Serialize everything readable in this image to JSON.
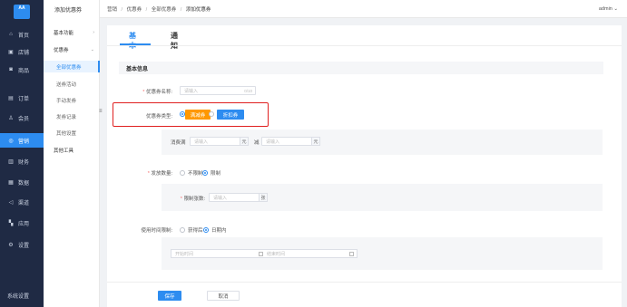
{
  "sidebar": {
    "logo_text": "AA",
    "items": [
      {
        "label": "首页",
        "icon": "home-icon",
        "glyph": "⌂"
      },
      {
        "label": "店铺",
        "icon": "store-icon",
        "glyph": "▣"
      },
      {
        "label": "商品",
        "icon": "goods-icon",
        "glyph": "◙"
      },
      {
        "label": "订单",
        "icon": "order-icon",
        "glyph": "▤"
      },
      {
        "label": "会员",
        "icon": "member-icon",
        "glyph": "♙"
      },
      {
        "label": "营销",
        "icon": "marketing-icon",
        "glyph": "◎"
      },
      {
        "label": "财务",
        "icon": "finance-icon",
        "glyph": "▥"
      },
      {
        "label": "数据",
        "icon": "data-icon",
        "glyph": "▦"
      },
      {
        "label": "渠道",
        "icon": "channel-icon",
        "glyph": "◁"
      },
      {
        "label": "应用",
        "icon": "apps-icon",
        "glyph": "▚"
      },
      {
        "label": "设置",
        "icon": "settings-icon",
        "glyph": "⚙"
      }
    ],
    "active_index": 5,
    "system_settings": "系统设置"
  },
  "subnav": {
    "title": "添加优惠券",
    "items": [
      {
        "label": "基本功能",
        "type": "group",
        "arrow": "›"
      },
      {
        "label": "优惠券",
        "type": "group",
        "arrow": "⌄"
      },
      {
        "label": "全部优惠券",
        "type": "child",
        "active": true
      },
      {
        "label": "送券活动",
        "type": "child"
      },
      {
        "label": "手动发券",
        "type": "child"
      },
      {
        "label": "发券记录",
        "type": "child"
      },
      {
        "label": "其他设置",
        "type": "child"
      },
      {
        "label": "其他工具",
        "type": "group"
      }
    ],
    "collapse_glyph": "≡"
  },
  "header": {
    "breadcrumb": [
      "营销",
      "优惠券",
      "全部优惠券",
      "添加优惠券"
    ],
    "separator": "/",
    "user": "admin ⌄"
  },
  "tabs": [
    {
      "label": "基本"
    },
    {
      "label": "通知"
    }
  ],
  "form": {
    "section_title": "基本信息",
    "name_label": "优惠券名称:",
    "name_placeholder": "请输入",
    "name_counter": "0/10",
    "type_label": "优惠券类型:",
    "type_options": [
      "满减券",
      "折扣券"
    ],
    "spend_label": "消费满",
    "spend_placeholder": "请输入",
    "unit": "元",
    "minus_label": "减",
    "minus_placeholder": "请输入",
    "quantity_label": "发放数量:",
    "quantity_options": [
      "不限制",
      "限制"
    ],
    "limit_label": "限制张数:",
    "limit_placeholder": "请输入",
    "limit_unit": "张",
    "time_label": "使用时间限制:",
    "time_options": [
      "获得后",
      "日期内"
    ],
    "start_placeholder": "开始时间",
    "date_separator": "-",
    "end_placeholder": "结束时间",
    "required_mark": "*"
  },
  "footer": {
    "save_label": "保存",
    "cancel_label": "取消"
  },
  "colors": {
    "primary": "#2d8cf0",
    "sidebar_bg": "#1f2a44",
    "orange": "#ff9800",
    "highlight": "#e02020"
  }
}
